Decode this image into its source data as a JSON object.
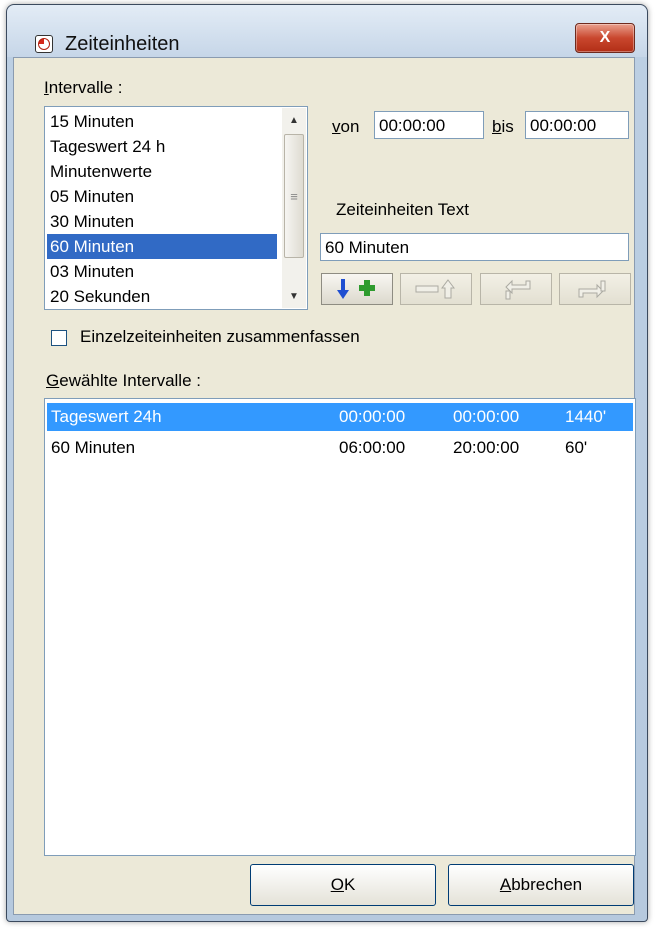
{
  "window": {
    "title": "Zeiteinheiten",
    "close_glyph": "X"
  },
  "intervals": {
    "label_mnemonic": "I",
    "label_rest": "ntervalle :",
    "items": [
      "15 Minuten",
      "Tageswert 24 h",
      "Minutenwerte",
      "05 Minuten",
      "30 Minuten",
      "60 Minuten",
      "03 Minuten",
      "20 Sekunden"
    ],
    "selected_index": 5
  },
  "range": {
    "from_mnemonic": "v",
    "from_rest": "on",
    "from_value": "00:00:00",
    "to_mnemonic": "b",
    "to_rest": "is",
    "to_value": "00:00:00"
  },
  "text_field": {
    "label": "Zeiteinheiten Text",
    "value": "60 Minuten"
  },
  "toolbar": {
    "icons": [
      "add-down-icon",
      "remove-up-icon",
      "move-down-icon",
      "move-up-icon"
    ],
    "accent_add": "#2e9b2e",
    "accent_arrow": "#1f4fd1"
  },
  "merge_checkbox": {
    "label": "Einzelzeiteinheiten zusammenfassen",
    "checked": false
  },
  "selected": {
    "label_mnemonic": "G",
    "label_rest": "ewählte Intervalle :",
    "rows": [
      {
        "name": "Tageswert 24h",
        "from": "00:00:00",
        "to": "00:00:00",
        "minutes": "1440'"
      },
      {
        "name": "60 Minuten",
        "from": "06:00:00",
        "to": "20:00:00",
        "minutes": "60'"
      }
    ],
    "selected_index": 0
  },
  "buttons": {
    "ok_mnemonic": "O",
    "ok_rest": "K",
    "cancel_mnemonic": "A",
    "cancel_rest": "bbrechen"
  }
}
